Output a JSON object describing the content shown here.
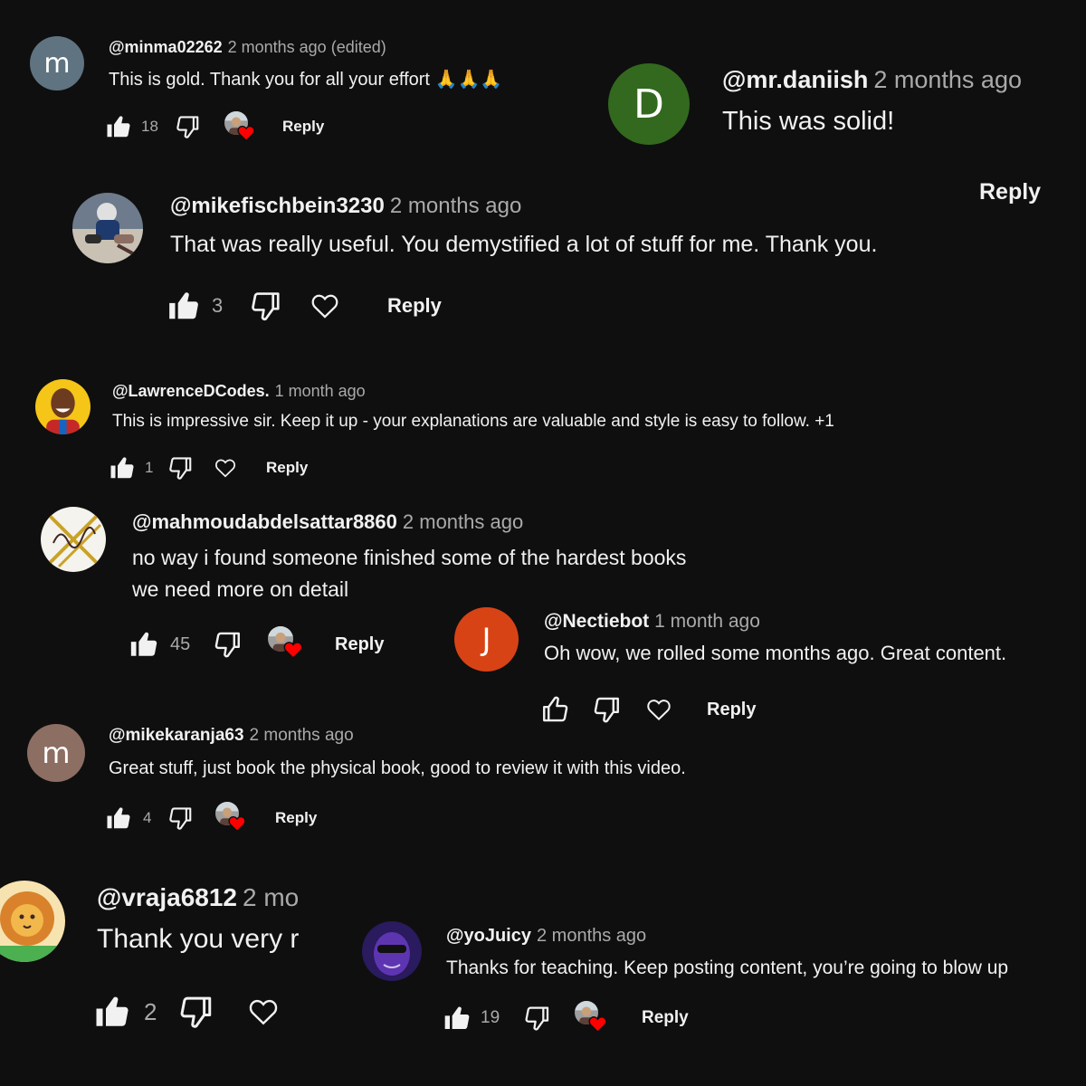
{
  "colors": {
    "background": "#0f0f0f",
    "text": "#f1f1f1",
    "muted": "#aaaaaa",
    "heart": "#ff0000"
  },
  "comments": {
    "minma": {
      "avatar_letter": "m",
      "avatar_color": "#5f7380",
      "author": "@minma02262",
      "meta": "2 months ago (edited)",
      "text": "This is gold. Thank you for all your effort 🙏🙏🙏",
      "likes": "18",
      "reply": "Reply",
      "liked_by_creator": true
    },
    "daniish": {
      "avatar_letter": "D",
      "avatar_color": "#33691e",
      "author": "@mr.daniish",
      "meta": "2 months ago",
      "text": "This was solid!",
      "reply": "Reply"
    },
    "mikefischbein": {
      "avatar_icon": "hockey-player-avatar",
      "author": "@mikefischbein3230",
      "meta": "2 months ago",
      "text": "That was really useful. You demystified a lot of stuff for me. Thank you.",
      "likes": "3",
      "reply": "Reply"
    },
    "lawrence": {
      "avatar_icon": "smiling-man-avatar",
      "avatar_color": "#f5c518",
      "author": "@LawrenceDCodes.",
      "meta": "1 month ago",
      "text": "This is impressive sir. Keep it up - your explanations are valuable and style is easy to follow.  +1",
      "likes": "1",
      "reply": "Reply"
    },
    "mahmoud": {
      "avatar_icon": "gold-signature-avatar",
      "author": "@mahmoudabdelsattar8860",
      "meta": "2 months ago",
      "text_line1": "no way i found someone finished some of the hardest books",
      "text_line2": "we need more on detail",
      "likes": "45",
      "reply": "Reply",
      "liked_by_creator": true
    },
    "nectiebot": {
      "avatar_letter": "J",
      "avatar_color": "#d84315",
      "author": "@Nectiebot",
      "meta": "1 month ago",
      "text": "Oh wow, we rolled some months ago. Great content.",
      "reply": "Reply"
    },
    "mikekaranja": {
      "avatar_letter": "m",
      "avatar_color": "#8d6e63",
      "author": "@mikekaranja63",
      "meta": "2 months ago",
      "text": "Great stuff, just book the physical book, good to review it with this video.",
      "likes": "4",
      "reply": "Reply",
      "liked_by_creator": true
    },
    "vraja": {
      "avatar_icon": "lion-avatar",
      "author": "@vraja6812",
      "meta": "2 mo",
      "text": "Thank you very r",
      "likes": "2"
    },
    "yojuicy": {
      "avatar_icon": "purple-face-avatar",
      "author": "@yoJuicy",
      "meta": "2 months ago",
      "text": "Thanks for teaching. Keep posting content, you’re going to blow up",
      "likes": "19",
      "reply": "Reply",
      "liked_by_creator": true
    },
    "floating_reply": "Reply"
  }
}
